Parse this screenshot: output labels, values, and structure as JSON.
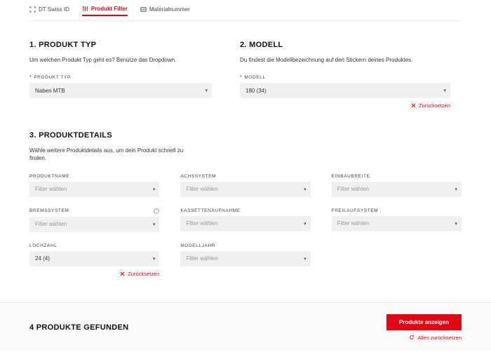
{
  "tabs": {
    "dtswiss": "DT Swiss ID",
    "filter": "Produkt Filter",
    "material": "Materialnummer"
  },
  "step1": {
    "heading": "1. PRODUKT TYP",
    "desc": "Um welchen Produkt Typ geht es? Benütze das Dropdown.",
    "label": "PRODUKT TYP",
    "value": "Naben MTB"
  },
  "step2": {
    "heading": "2. MODELL",
    "desc": "Du findest die Modellbezeichnung auf den Stickern deines Produktes.",
    "label": "MODELL",
    "value": "180 (34)",
    "reset": "Zurücksetzen"
  },
  "step3": {
    "heading": "3. PRODUKTDETAILS",
    "desc": "Wähle weitere Produktdetails aus, um dein Produkt schnell zu finden.",
    "placeholder": "Filter wählen",
    "fields": {
      "produktname": "PRODUKTNAME",
      "achssystem": "ACHSSYSTEM",
      "einbaubreite": "EINBAUBREITE",
      "bremssystem": "BREMSSYSTEM",
      "kassettenaufnahme": "KASSETTENAUFNAHME",
      "freilaufsystem": "FREILAUFSYSTEM",
      "lochzahl": "LOCHZAHL",
      "modelljahr": "MODELLJAHR"
    },
    "lochzahl_value": "24 (4)",
    "reset": "Zurücksetzen"
  },
  "footer": {
    "count": "4 PRODUKTE GEFUNDEN",
    "cta": "Produkte anzeigen",
    "reset_all": "Alles zurücksetzen"
  }
}
